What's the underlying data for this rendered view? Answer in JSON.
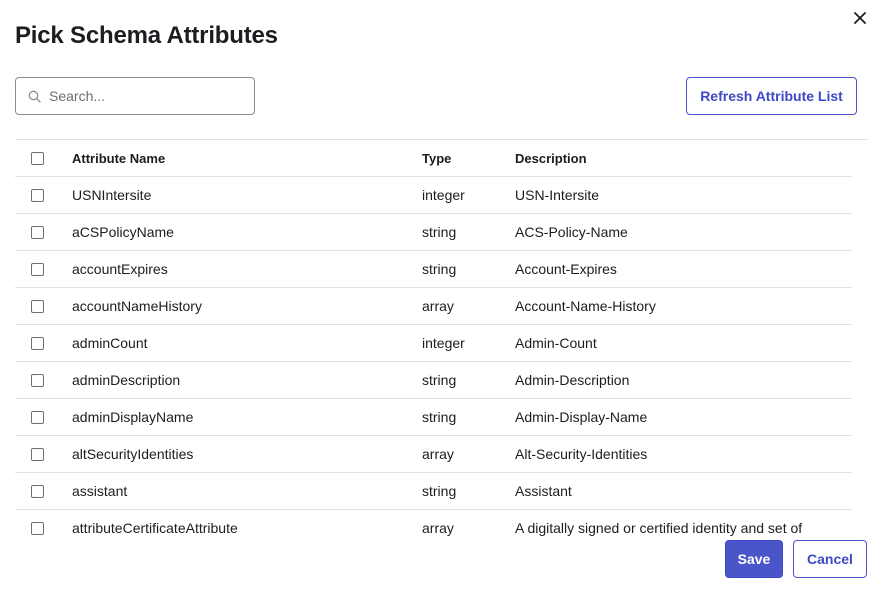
{
  "dialog": {
    "title": "Pick Schema Attributes",
    "close_icon": "close-icon"
  },
  "search": {
    "placeholder": "Search...",
    "value": "",
    "icon": "search-icon"
  },
  "toolbar": {
    "refresh_label": "Refresh Attribute List"
  },
  "table": {
    "columns": [
      "Attribute Name",
      "Type",
      "Description"
    ],
    "rows": [
      {
        "name": "USNIntersite",
        "type": "integer",
        "description": "USN-Intersite"
      },
      {
        "name": "aCSPolicyName",
        "type": "string",
        "description": "ACS-Policy-Name"
      },
      {
        "name": "accountExpires",
        "type": "string",
        "description": "Account-Expires"
      },
      {
        "name": "accountNameHistory",
        "type": "array",
        "description": "Account-Name-History"
      },
      {
        "name": "adminCount",
        "type": "integer",
        "description": "Admin-Count"
      },
      {
        "name": "adminDescription",
        "type": "string",
        "description": "Admin-Description"
      },
      {
        "name": "adminDisplayName",
        "type": "string",
        "description": "Admin-Display-Name"
      },
      {
        "name": "altSecurityIdentities",
        "type": "array",
        "description": "Alt-Security-Identities"
      },
      {
        "name": "assistant",
        "type": "string",
        "description": "Assistant"
      },
      {
        "name": "attributeCertificateAttribute",
        "type": "array",
        "description": "A digitally signed or certified identity and set of"
      }
    ]
  },
  "footer": {
    "save_label": "Save",
    "cancel_label": "Cancel"
  },
  "colors": {
    "accent": "#4a55c9",
    "text": "#1d1d21",
    "border": "#e1e1e6"
  }
}
